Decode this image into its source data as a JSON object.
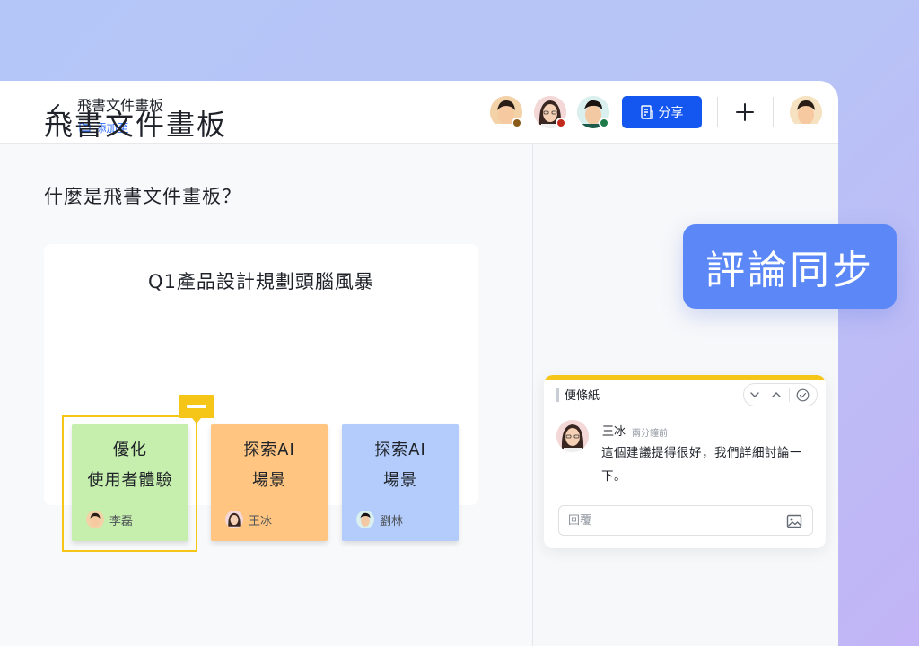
{
  "header": {
    "doc_title": "飛書文件畫板",
    "add_to_label": "添加至",
    "share_label": "分享",
    "collaborators": [
      {
        "name": "collaborator-1",
        "status_color": "#8a5a18"
      },
      {
        "name": "collaborator-2",
        "status_color": "#c22a1c"
      },
      {
        "name": "collaborator-3",
        "status_color": "#1f7a4a"
      }
    ]
  },
  "document": {
    "heading": "飛書文件畫板",
    "question": "什麼是飛書文件畫板？",
    "board": {
      "title": "Q1產品設計規劃頭腦風暴",
      "stickies": [
        {
          "line1": "優化",
          "line2": "使用者體驗",
          "user": "李磊",
          "color": "#c6eeac"
        },
        {
          "line1": "探索AI",
          "line2": "場景",
          "user": "王冰",
          "color": "#ffc581"
        },
        {
          "line1": "探索AI",
          "line2": "場景",
          "user": "劉林",
          "color": "#b4ccfb"
        }
      ]
    }
  },
  "callout": {
    "text": "評論同步"
  },
  "comment_card": {
    "label": "便條紙",
    "author": "王冰",
    "time": "兩分鐘前",
    "text": "這個建議提得很好，我們詳細討論一下。",
    "reply_placeholder": "回覆"
  },
  "colors": {
    "accent": "#1456f0",
    "sticky_highlight": "#f5c518",
    "callout": "#5b87f7"
  },
  "icons": [
    "back-icon",
    "folder-icon",
    "share-doc-icon",
    "plus-icon",
    "chevron-down-icon",
    "chevron-up-icon",
    "check-circle-icon",
    "comment-marker-icon",
    "image-icon"
  ]
}
